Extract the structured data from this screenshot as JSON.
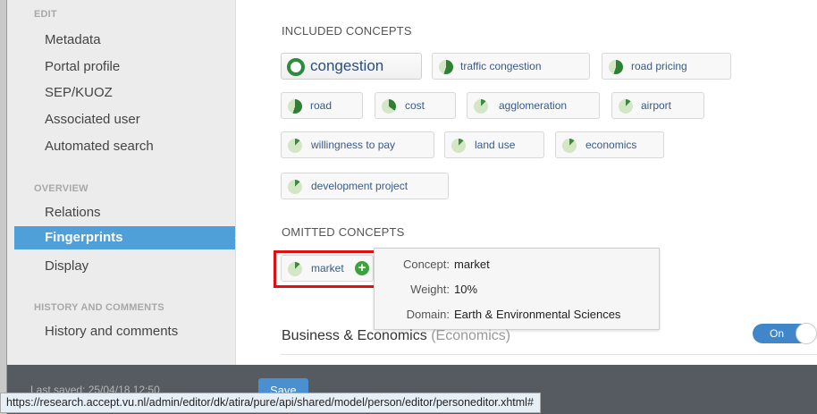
{
  "sidebar": {
    "sections": [
      {
        "title": "EDIT",
        "items": [
          "Metadata",
          "Portal profile",
          "SEP/KUOZ",
          "Associated user",
          "Automated search"
        ]
      },
      {
        "title": "OVERVIEW",
        "items": [
          "Relations",
          "Fingerprints",
          "Display"
        ]
      },
      {
        "title": "HISTORY AND COMMENTS",
        "items": [
          "History and comments"
        ]
      }
    ],
    "active_item": "Fingerprints"
  },
  "main": {
    "included_header": "INCLUDED CONCEPTS",
    "included_concepts": [
      "congestion",
      "traffic congestion",
      "road pricing",
      "road",
      "cost",
      "agglomeration",
      "airport",
      "willingness to pay",
      "land use",
      "economics",
      "development project"
    ],
    "omitted_header": "OMITTED CONCEPTS",
    "omitted_concepts": [
      "market"
    ],
    "tooltip": {
      "concept_label": "Concept:",
      "concept_value": "market",
      "weight_label": "Weight:",
      "weight_value": "10%",
      "domain_label": "Domain:",
      "domain_value": "Earth & Environmental Sciences"
    },
    "category_row": {
      "label": "Business & Economics",
      "sub": "(Economics)",
      "toggle": "On"
    }
  },
  "footer": {
    "last_saved": "Last saved: 25/04/18 12:50",
    "save_label": "Save"
  },
  "statusbar": {
    "url": "https://research.accept.vu.nl/admin/editor/dk/atira/pure/api/shared/model/person/editor/personeditor.xhtml#"
  },
  "colors": {
    "accent": "#4f9fd8",
    "highlight_border": "#e01010",
    "concept_green": "#2e8a3c",
    "footer": "#555b60"
  }
}
